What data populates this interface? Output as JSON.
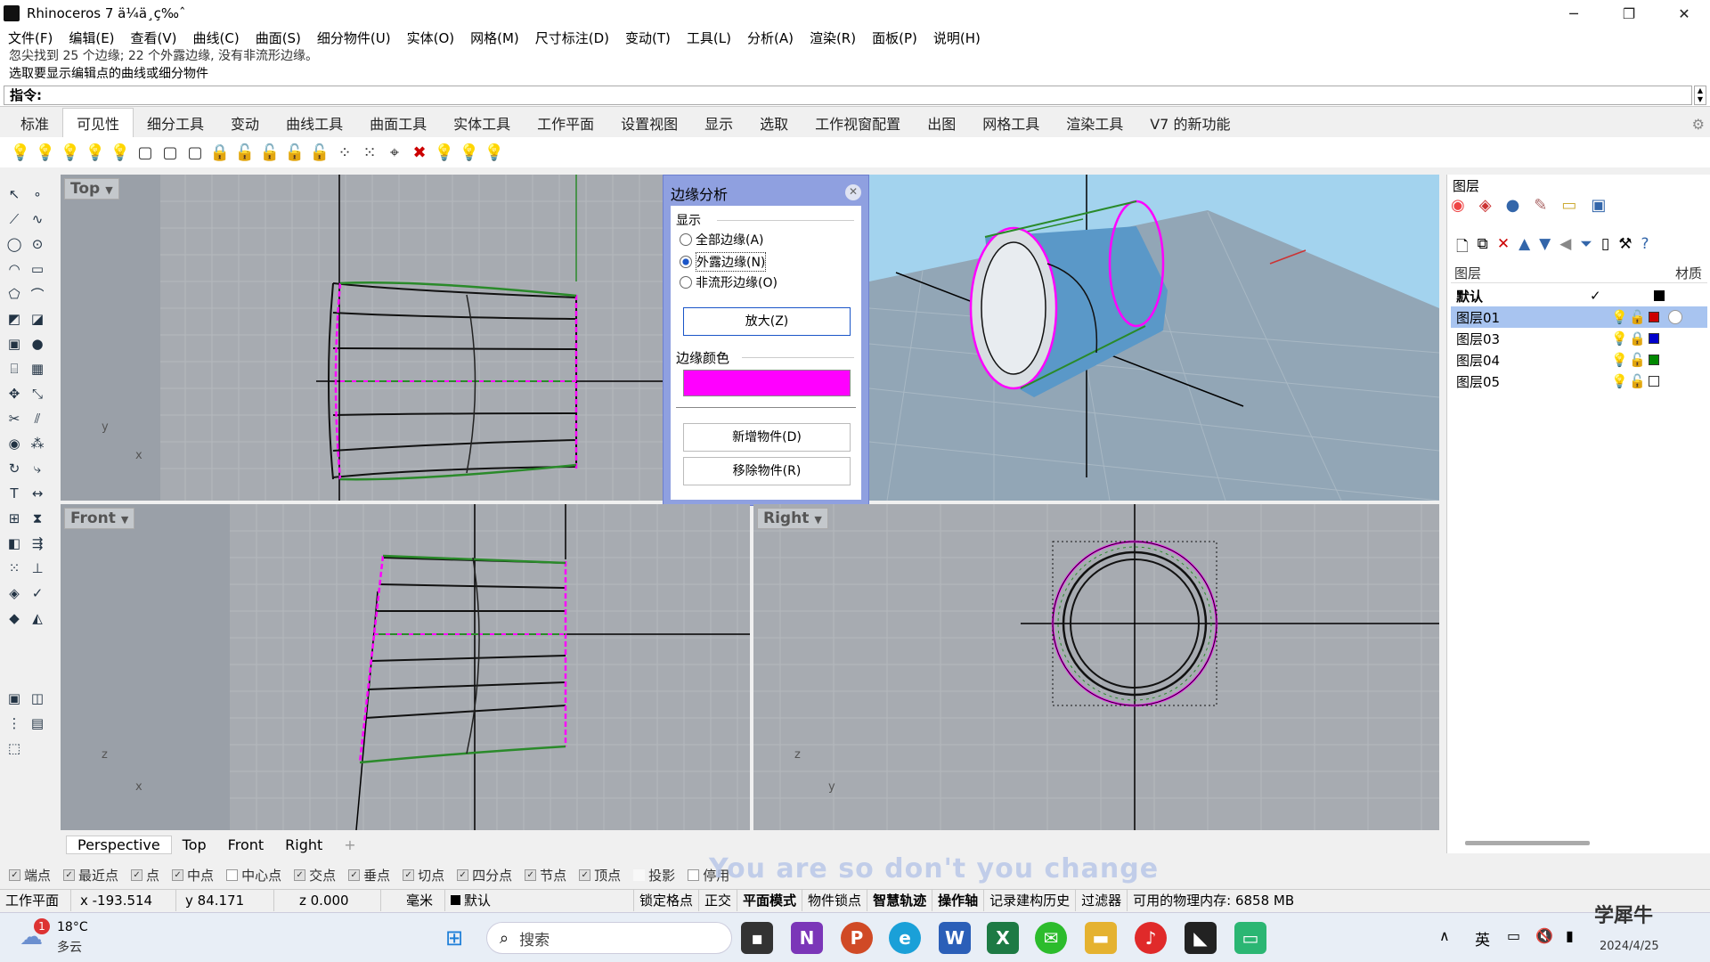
{
  "window": {
    "title": "Rhinoceros 7 ä¼ä¸ç‰ˆ",
    "minimize": "─",
    "maximize": "❐",
    "close": "✕"
  },
  "menu": [
    "文件(F)",
    "编辑(E)",
    "查看(V)",
    "曲线(C)",
    "曲面(S)",
    "细分物件(U)",
    "实体(O)",
    "网格(M)",
    "尺寸标注(D)",
    "变动(T)",
    "工具(L)",
    "分析(A)",
    "渲染(R)",
    "面板(P)",
    "说明(H)"
  ],
  "command": {
    "line1": "忽尖找到 25 个边缘; 22 个外露边缘, 没有非流形边缘。",
    "line2": "选取要显示编辑点的曲线或细分物件",
    "prompt": "指令:"
  },
  "ribbon_tabs": [
    "标准",
    "可见性",
    "细分工具",
    "变动",
    "曲线工具",
    "曲面工具",
    "实体工具",
    "工作平面",
    "设置视图",
    "显示",
    "选取",
    "工作视窗配置",
    "出图",
    "网格工具",
    "渲染工具",
    "V7 的新功能"
  ],
  "ribbon_active": "可见性",
  "viewports": {
    "top": "Top",
    "front": "Front",
    "right": "Right"
  },
  "dialog": {
    "title": "边缘分析",
    "display_label": "显示",
    "opt_all": "全部边缘(A)",
    "opt_naked": "外露边缘(N)",
    "opt_nonmanifold": "非流形边缘(O)",
    "zoom": "放大(Z)",
    "color_label": "边缘颜色",
    "edge_color": "#ff00ff",
    "add": "新增物件(D)",
    "remove": "移除物件(R)"
  },
  "layers": {
    "panel_title": "图层",
    "col_layer": "图层",
    "col_material": "材质",
    "rows": [
      {
        "name": "默认",
        "color": "#000000"
      },
      {
        "name": "图层01",
        "color": "#cc0000"
      },
      {
        "name": "图层03",
        "color": "#0000cc"
      },
      {
        "name": "图层04",
        "color": "#008800"
      },
      {
        "name": "图层05",
        "color": "#ffffff"
      }
    ]
  },
  "view_tabs": [
    "Perspective",
    "Top",
    "Front",
    "Right"
  ],
  "osnaps": [
    "端点",
    "最近点",
    "点",
    "中点",
    "中心点",
    "交点",
    "垂点",
    "切点",
    "四分点",
    "节点",
    "顶点",
    "投影",
    "停用"
  ],
  "status": {
    "cplane": "工作平面",
    "x": "x -193.514",
    "y": "y 84.171",
    "z": "z 0.000",
    "unit": "毫米",
    "layer": "默认",
    "grid": "锁定格点",
    "ortho": "正交",
    "planar": "平面模式",
    "osnap": "物件锁点",
    "smarttrack": "智慧轨迹",
    "gumball": "操作轴",
    "history": "记录建构历史",
    "filter": "过滤器",
    "memory": "可用的物理内存: 6858 MB"
  },
  "lyric": "You are so don't you change",
  "taskbar": {
    "temp": "18°C",
    "weather": "多云",
    "search": "搜索",
    "ime": "英",
    "date": "2024/4/25",
    "badge": "1"
  },
  "watermark": "学犀牛"
}
